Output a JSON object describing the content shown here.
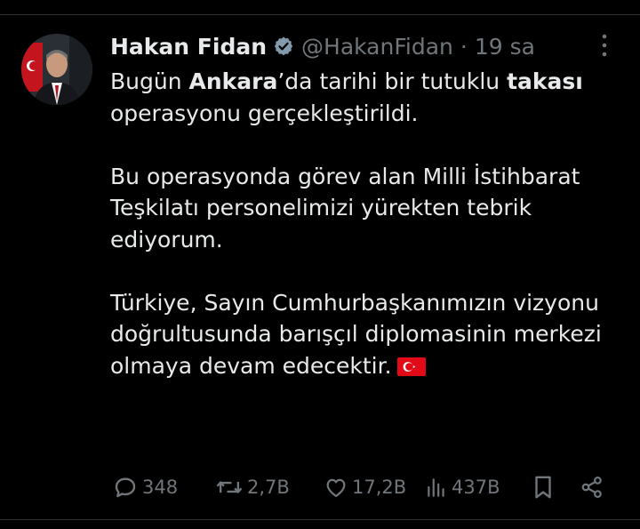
{
  "tweet": {
    "display_name": "Hakan Fidan",
    "handle": "@HakanFidan",
    "separator": "·",
    "time": "19 sa",
    "verified": true,
    "paragraphs": [
      [
        {
          "text": "Bugün ",
          "bold": false
        },
        {
          "text": "Ankara",
          "bold": true
        },
        {
          "text": "’da tarihi bir tutuklu ",
          "bold": false
        },
        {
          "text": "takası",
          "bold": true
        },
        {
          "text": " operasyonu gerçekleştirildi.",
          "bold": false
        }
      ],
      [
        {
          "text": "Bu operasyonda görev alan Milli İstihbarat Teşkilatı personelimizi yürekten tebrik ediyorum.",
          "bold": false
        }
      ],
      [
        {
          "text": "Türkiye, Sayın Cumhurbaşkanımızın vizyonu doğrultusunda barışçıl diplomasinin merkezi olmaya devam edecektir.",
          "bold": false
        }
      ]
    ],
    "emoji": "turkey-flag"
  },
  "actions": {
    "replies": "348",
    "reposts": "2,7B",
    "likes": "17,2B",
    "views": "437B"
  },
  "icons": {
    "more": "more-vertical-icon",
    "verified": "verified-badge-icon",
    "reply": "reply-icon",
    "repost": "repost-icon",
    "like": "heart-icon",
    "views": "views-icon",
    "bookmark": "bookmark-icon",
    "share": "share-icon"
  },
  "colors": {
    "background": "#000000",
    "text": "#e7e9ea",
    "muted": "#71767b",
    "flag_red": "#e30a17"
  }
}
